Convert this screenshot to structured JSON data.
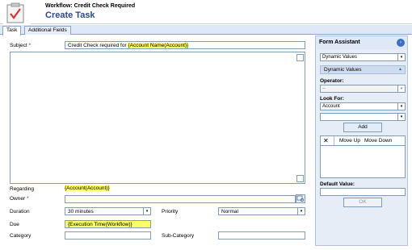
{
  "header": {
    "subtitle": "Workflow: Credit Check Required",
    "title": "Create Task"
  },
  "tabs": [
    {
      "label": "Task",
      "active": true
    },
    {
      "label": "Additional Fields",
      "active": false
    }
  ],
  "form": {
    "subject_label": "Subject",
    "subject_prefix": "Credit Check required for",
    "subject_token": "{Account Name(Account)}",
    "regarding_label": "Regarding",
    "regarding_value": "{Account(Account)}",
    "owner_label": "Owner",
    "duration_label": "Duration",
    "duration_value": "30 minutes",
    "priority_label": "Priority",
    "priority_value": "Normal",
    "due_label": "Due",
    "due_value": "{Execution Time(Workflow)}",
    "category_label": "Category",
    "subcategory_label": "Sub-Category",
    "required_mark": "*"
  },
  "assistant": {
    "title": "Form Assistant",
    "dynamic_select": "Dynamic Values",
    "dynamic_section": "Dynamic Values",
    "operator_label": "Operator:",
    "operator_value": "--",
    "lookfor_label": "Look For:",
    "lookfor_value": "Account",
    "add_button": "Add",
    "move_up": "Move Up",
    "move_down": "Move Down",
    "delete_glyph": "✕",
    "default_label": "Default Value:",
    "ok_button": "OK"
  },
  "icons": {
    "dropdown": "▾",
    "collapse": "▲",
    "go": "›"
  }
}
